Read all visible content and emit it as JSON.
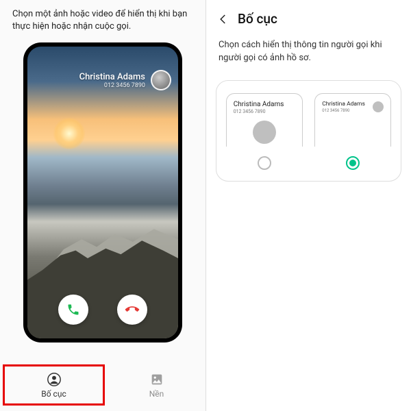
{
  "left": {
    "description": "Chọn một ảnh hoặc video để hiển thị khi bạn thực hiện hoặc nhận cuộc gọi.",
    "caller_name": "Christina Adams",
    "caller_number": "012 3456 7890",
    "tabs": {
      "layout": "Bố cục",
      "background": "Nền"
    }
  },
  "right": {
    "title": "Bố cục",
    "description": "Chọn cách hiển thị thông tin người gọi khi người gọi có ảnh hồ sơ.",
    "options": {
      "a": {
        "name": "Christina Adams",
        "number": "012 3456 7890",
        "selected": false
      },
      "b": {
        "name": "Christina Adams",
        "number": "012 3456 7890",
        "selected": true
      }
    }
  },
  "colors": {
    "accent": "#00c38a",
    "highlight": "#e60000"
  }
}
